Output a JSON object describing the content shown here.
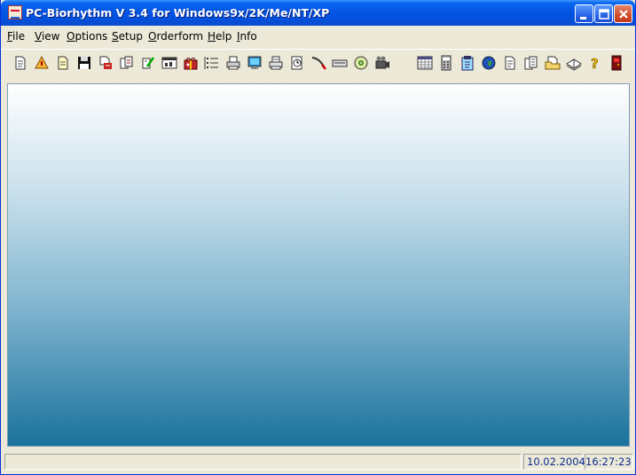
{
  "window": {
    "title": "PC-Biorhythm V 3.4 for Windows9x/2K/Me/NT/XP"
  },
  "menu": [
    {
      "label": "File"
    },
    {
      "label": "View"
    },
    {
      "label": "Options"
    },
    {
      "label": "Setup"
    },
    {
      "label": "Orderform"
    },
    {
      "label": "Help"
    },
    {
      "label": "Info"
    }
  ],
  "toolbar_icons": [
    "new-document-icon",
    "warning-sign-icon",
    "open-document-icon",
    "save-disk-icon",
    "print-setup-icon",
    "copy-document-icon",
    "edit-pen-icon",
    "chart-window-icon",
    "gift-box-icon",
    "list-view-icon",
    "printer-icon",
    "monitor-icon",
    "printer-preview-icon",
    "clock-icon",
    "pen-tool-icon",
    "keyboard-icon",
    "cd-disc-icon",
    "camera-icon",
    "calendar-icon",
    "calculator-icon",
    "notepad-icon",
    "globe-icon",
    "text-file-icon",
    "documents-icon",
    "folder-icon",
    "book-icon",
    "help-icon",
    "exit-icon"
  ],
  "status": {
    "message": "",
    "date": "10.02.2004",
    "time": "16:27:23"
  }
}
